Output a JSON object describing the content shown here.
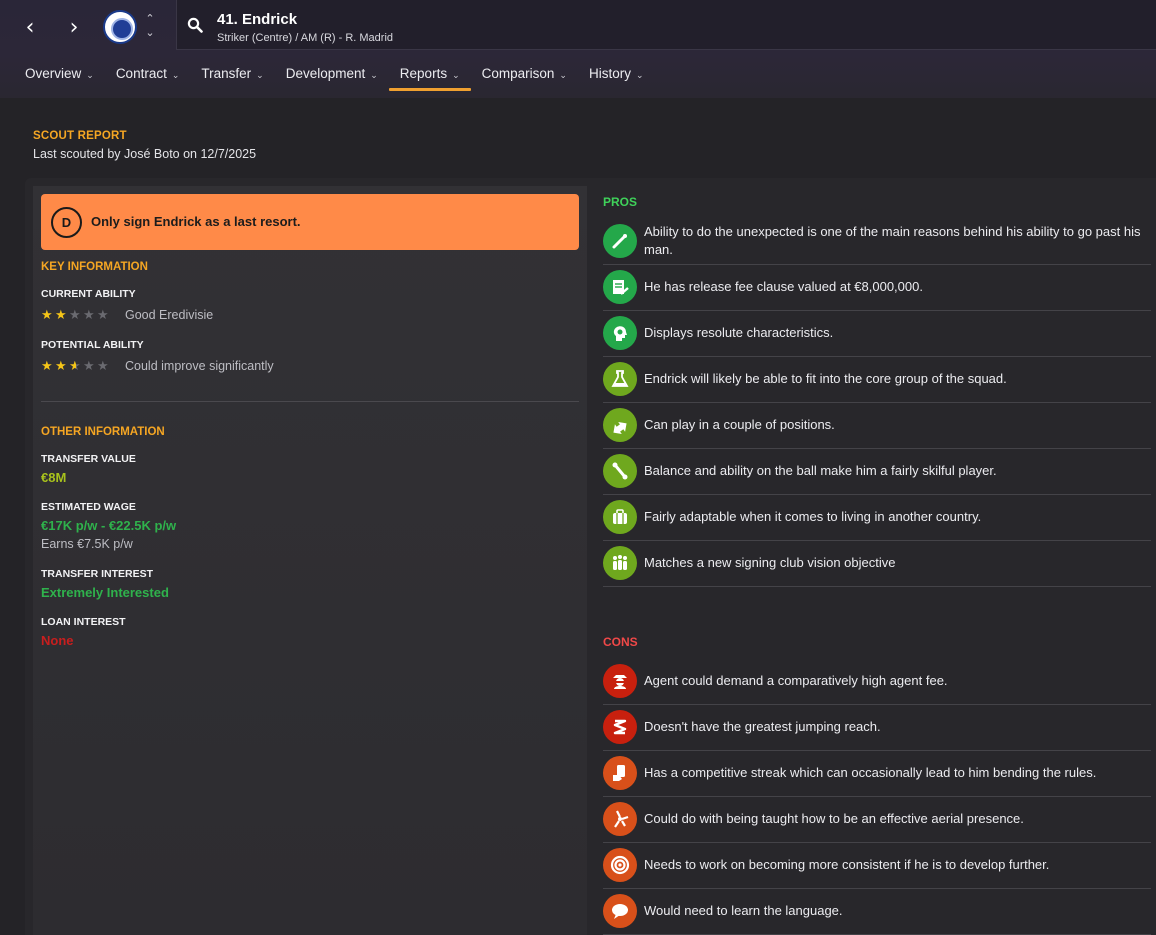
{
  "header": {
    "player_name": "41. Endrick",
    "player_sub": "Striker (Centre) / AM (R) - R. Madrid"
  },
  "tabs": [
    {
      "label": "Overview"
    },
    {
      "label": "Contract"
    },
    {
      "label": "Transfer"
    },
    {
      "label": "Development"
    },
    {
      "label": "Reports"
    },
    {
      "label": "Comparison"
    },
    {
      "label": "History"
    }
  ],
  "active_tab": "Reports",
  "report": {
    "title": "SCOUT REPORT",
    "subtitle": "Last scouted by José Boto on 12/7/2025",
    "grade": "D",
    "recommendation": "Only sign Endrick as a last resort.",
    "key_information": {
      "heading": "KEY INFORMATION",
      "current_ability": {
        "label": "CURRENT ABILITY",
        "stars": 2,
        "max": 5,
        "desc": "Good Eredivisie"
      },
      "potential_ability": {
        "label": "POTENTIAL ABILITY",
        "stars": 2.5,
        "max": 5,
        "desc": "Could improve significantly"
      }
    },
    "other_information": {
      "heading": "OTHER INFORMATION",
      "transfer_value_label": "TRANSFER VALUE",
      "transfer_value": "€8M",
      "estimated_wage_label": "ESTIMATED WAGE",
      "estimated_wage": "€17K p/w - €22.5K p/w",
      "earns": "Earns €7.5K p/w",
      "transfer_interest_label": "TRANSFER INTEREST",
      "transfer_interest": "Extremely Interested",
      "loan_interest_label": "LOAN INTEREST",
      "loan_interest": "None"
    }
  },
  "pros": {
    "heading": "PROS",
    "items": [
      {
        "text": "Ability to do the unexpected is one of the main reasons behind his ability to go past his man.",
        "icon": "magic-wand-icon",
        "color": "#24a84a"
      },
      {
        "text": "He has release fee clause valued at €8,000,000.",
        "icon": "contract-icon",
        "color": "#24a84a"
      },
      {
        "text": "Displays resolute characteristics.",
        "icon": "head-icon",
        "color": "#24a84a"
      },
      {
        "text": "Endrick will likely be able to fit into the core group of the squad.",
        "icon": "flask-icon",
        "color": "#6fa81e"
      },
      {
        "text": "Can play in a couple of positions.",
        "icon": "swap-arrows-icon",
        "color": "#6fa81e"
      },
      {
        "text": "Balance and ability on the ball make him a fairly skilful player.",
        "icon": "dribble-icon",
        "color": "#6fa81e"
      },
      {
        "text": "Fairly adaptable when it comes to living in another country.",
        "icon": "suitcase-icon",
        "color": "#6fa81e"
      },
      {
        "text": "Matches a new signing club vision objective",
        "icon": "group-icon",
        "color": "#6fa81e"
      }
    ]
  },
  "cons": {
    "heading": "CONS",
    "items": [
      {
        "text": "Agent could demand a comparatively high agent fee.",
        "icon": "agent-icon",
        "color": "#c8200e"
      },
      {
        "text": "Doesn't have the greatest jumping reach.",
        "icon": "spring-icon",
        "color": "#c8200e"
      },
      {
        "text": "Has a competitive streak which can occasionally lead to him bending the rules.",
        "icon": "card-icon",
        "color": "#d8501a"
      },
      {
        "text": "Could do with being taught how to be an effective aerial presence.",
        "icon": "header-icon",
        "color": "#d8501a"
      },
      {
        "text": "Needs to work on becoming more consistent if he is to develop further.",
        "icon": "target-icon",
        "color": "#d8501a"
      },
      {
        "text": "Would need to learn the language.",
        "icon": "speech-bubble-icon",
        "color": "#d8501a"
      }
    ]
  }
}
